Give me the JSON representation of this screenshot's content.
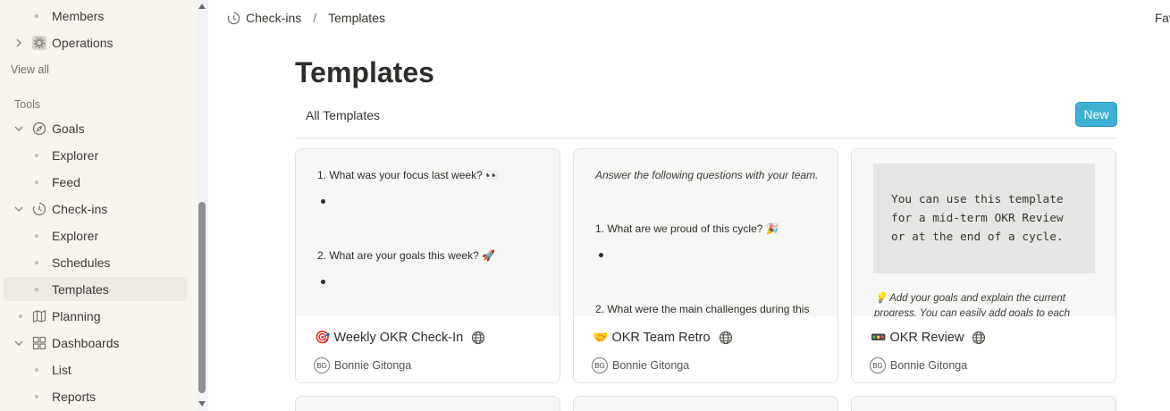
{
  "sidebar": {
    "items": [
      {
        "label": "Members",
        "kind": "child"
      },
      {
        "label": "Operations",
        "kind": "parent",
        "icon": "gear-icon"
      },
      {
        "label": "Goals",
        "kind": "parent",
        "icon": "compass-icon"
      },
      {
        "label": "Explorer",
        "kind": "child"
      },
      {
        "label": "Feed",
        "kind": "child"
      },
      {
        "label": "Check-ins",
        "kind": "parent",
        "icon": "clock-icon"
      },
      {
        "label": "Explorer",
        "kind": "child"
      },
      {
        "label": "Schedules",
        "kind": "child"
      },
      {
        "label": "Templates",
        "kind": "child",
        "active": true
      },
      {
        "label": "Planning",
        "kind": "parent",
        "icon": "map-icon"
      },
      {
        "label": "Dashboards",
        "kind": "parent",
        "icon": "grid-icon"
      },
      {
        "label": "List",
        "kind": "child"
      },
      {
        "label": "Reports",
        "kind": "child"
      }
    ],
    "view_all": "View all",
    "tools_title": "Tools"
  },
  "breadcrumb": {
    "parent": "Check-ins",
    "separator": "/",
    "current": "Templates"
  },
  "favorites_label": "Fav",
  "page": {
    "title": "Templates",
    "tab_all": "All Templates",
    "new_button": "New"
  },
  "cards": [
    {
      "emoji": "🎯",
      "title": "Weekly OKR Check-In",
      "author_initials": "BG",
      "author": "Bonnie Gitonga",
      "preview": {
        "q1": "1. What was your focus last week? 👀",
        "q2": "2. What are your goals this week? 🚀"
      }
    },
    {
      "emoji": "🤝",
      "title": "OKR Team Retro",
      "author_initials": "BG",
      "author": "Bonnie Gitonga",
      "preview": {
        "intro": "Answer the following questions with your team.",
        "q1": "1. What are we proud of this cycle? 🎉",
        "q2": "2. What were the main challenges during this"
      }
    },
    {
      "emoji": "🚥",
      "title": "OKR Review",
      "author_initials": "BG",
      "author": "Bonnie Gitonga",
      "preview": {
        "code": "You can use this template\nfor a mid-term OKR Review\nor at the end of a cycle.",
        "tip": "💡 Add your goals and explain the current progress. You can easily add goals to each"
      }
    }
  ],
  "colors": {
    "sidebar_bg": "#faf4ee",
    "accent": "#3fb0d3",
    "active_item": "#efe9e3"
  }
}
